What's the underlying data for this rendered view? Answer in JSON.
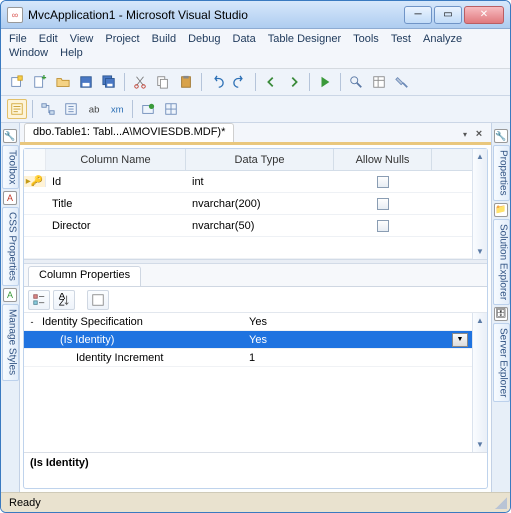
{
  "title": "MvcApplication1 - Microsoft Visual Studio",
  "menus": [
    "File",
    "Edit",
    "View",
    "Project",
    "Build",
    "Debug",
    "Data",
    "Table Designer",
    "Tools",
    "Test",
    "Analyze",
    "Window",
    "Help"
  ],
  "doc_tab": "dbo.Table1: Tabl...A\\MOVIESDB.MDF)*",
  "grid_headers": {
    "name": "Column Name",
    "type": "Data Type",
    "null": "Allow Nulls"
  },
  "columns": [
    {
      "name": "Id",
      "type": "int",
      "pk": true,
      "nullable": false
    },
    {
      "name": "Title",
      "type": "nvarchar(200)",
      "pk": false,
      "nullable": false
    },
    {
      "name": "Director",
      "type": "nvarchar(50)",
      "pk": false,
      "nullable": false
    }
  ],
  "props_tab": "Column Properties",
  "prop_rows": [
    {
      "name": "Identity Specification",
      "value": "Yes",
      "expand": "-",
      "indent": 0,
      "sel": false
    },
    {
      "name": "(Is Identity)",
      "value": "Yes",
      "expand": "",
      "indent": 1,
      "sel": true,
      "combo": true
    },
    {
      "name": "Identity Increment",
      "value": "1",
      "expand": "",
      "indent": 2,
      "sel": false
    }
  ],
  "help_title": "(Is Identity)",
  "status": "Ready",
  "left_tabs": [
    "Toolbox",
    "CSS Properties",
    "Manage Styles"
  ],
  "right_tabs": [
    "Properties",
    "Solution Explorer",
    "Server Explorer"
  ]
}
